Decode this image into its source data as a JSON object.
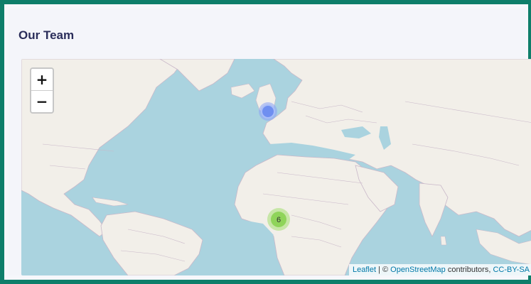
{
  "card": {
    "title": "Our Team"
  },
  "map": {
    "zoom_in_label": "+",
    "zoom_out_label": "−",
    "cluster_count": "6",
    "attribution": {
      "leaflet": "Leaflet",
      "separator": " | © ",
      "osm": "OpenStreetMap",
      "contributors": " contributors, ",
      "license": "CC-BY-SA"
    }
  },
  "colors": {
    "frame": "#0e7e6a",
    "ocean": "#aad3df",
    "land": "#f2efe9",
    "cluster_green": "#8fd45a",
    "marker_blue": "#6f8ff0"
  }
}
